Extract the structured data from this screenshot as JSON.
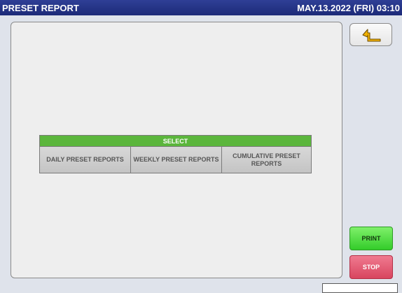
{
  "header": {
    "title": "PRESET REPORT",
    "datetime": "MAY.13.2022 (FRI) 03:10"
  },
  "select_panel": {
    "header": "SELECT",
    "options": [
      {
        "label": "DAILY PRESET REPORTS"
      },
      {
        "label": "WEEKLY PRESET REPORTS"
      },
      {
        "label": "CUMULATIVE PRESET REPORTS"
      }
    ]
  },
  "side_buttons": {
    "back_icon": "return-arrow-icon",
    "print_label": "PRINT",
    "stop_label": "STOP"
  },
  "colors": {
    "titlebar": "#1c2a78",
    "select_header": "#5bb63c",
    "print": "#33cc2a",
    "stop": "#d8455f",
    "back_arrow": "#f0a800"
  }
}
